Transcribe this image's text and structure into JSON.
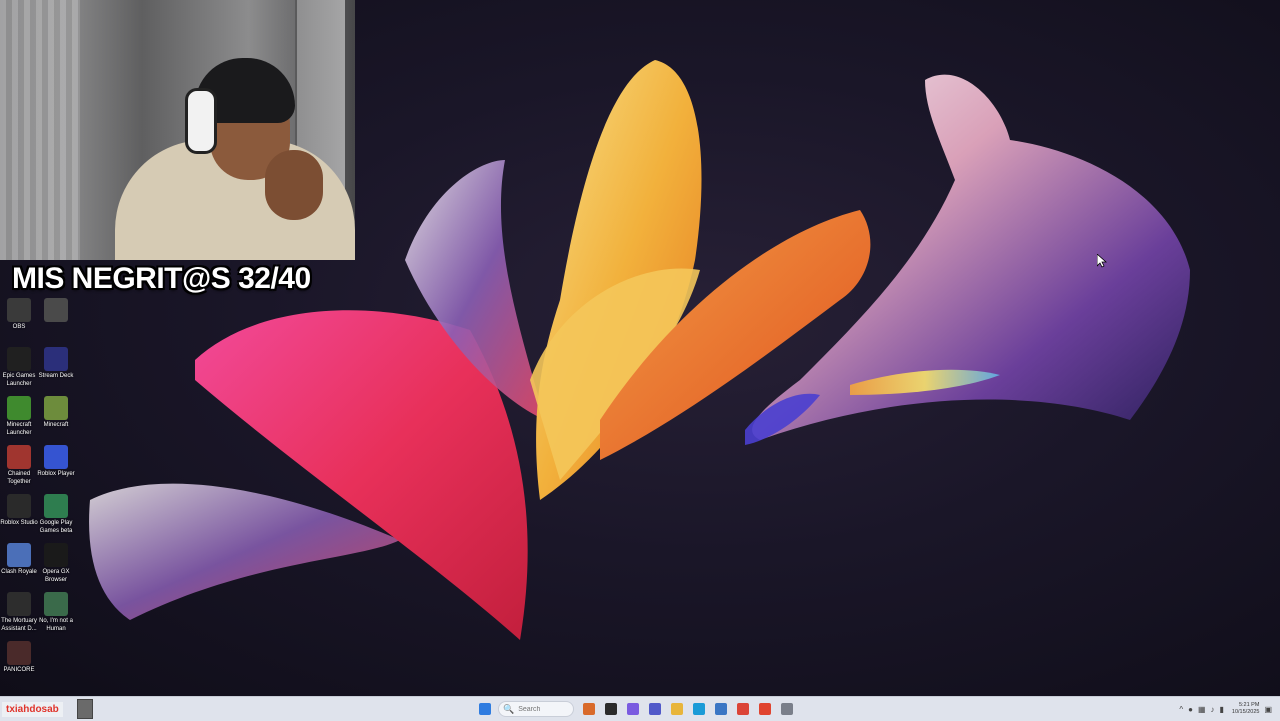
{
  "stream": {
    "title": "MIS NEGRIT@S 32/40"
  },
  "desktop_icons": [
    {
      "label": "OBS",
      "icon": "obs-icon",
      "color": "#3a3a3a"
    },
    {
      "label": "",
      "icon": "app-icon",
      "color": "#4a4a4a"
    },
    {
      "label": "Epic Games Launcher",
      "icon": "epic-games-icon",
      "color": "#202020"
    },
    {
      "label": "Stream Deck",
      "icon": "stream-deck-icon",
      "color": "#2b2f7a"
    },
    {
      "label": "Minecraft Launcher",
      "icon": "minecraft-launcher-icon",
      "color": "#3f8a2e"
    },
    {
      "label": "Minecraft",
      "icon": "minecraft-icon",
      "color": "#6d8c3c"
    },
    {
      "label": "Chained Together",
      "icon": "chained-together-icon",
      "color": "#a0352f"
    },
    {
      "label": "Roblox Player",
      "icon": "roblox-player-icon",
      "color": "#3554d1"
    },
    {
      "label": "Roblox Studio",
      "icon": "roblox-studio-icon",
      "color": "#2a2a2a"
    },
    {
      "label": "Google Play Games beta",
      "icon": "google-play-games-icon",
      "color": "#2e7d4f"
    },
    {
      "label": "Clash Royale",
      "icon": "clash-royale-icon",
      "color": "#4b6fb8"
    },
    {
      "label": "Opera GX Browser",
      "icon": "opera-gx-icon",
      "color": "#1a1a1a"
    },
    {
      "label": "The Mortuary Assistant D...",
      "icon": "mortuary-assistant-icon",
      "color": "#2d2d2d"
    },
    {
      "label": "No, I'm not a Human",
      "icon": "not-a-human-icon",
      "color": "#3a6a4a"
    },
    {
      "label": "PANICORE",
      "icon": "panicore-icon",
      "color": "#4a2a2a"
    }
  ],
  "taskbar": {
    "status_text": "txiahdosab",
    "search_placeholder": "Search",
    "pinned": [
      {
        "name": "start-button",
        "icon": "windows-icon",
        "color": "#2f7ce0"
      },
      {
        "name": "taskbar-widget",
        "icon": "widget-icon",
        "color": "#d96a2a"
      },
      {
        "name": "taskbar-terminal",
        "icon": "terminal-icon",
        "color": "#2b2b2b"
      },
      {
        "name": "taskbar-copilot",
        "icon": "copilot-icon",
        "color": "#7a5be0"
      },
      {
        "name": "taskbar-teams",
        "icon": "teams-icon",
        "color": "#5059c9"
      },
      {
        "name": "taskbar-file-explorer",
        "icon": "folder-icon",
        "color": "#e8b53a"
      },
      {
        "name": "taskbar-edge",
        "icon": "edge-icon",
        "color": "#1a9bd7"
      },
      {
        "name": "taskbar-store",
        "icon": "store-icon",
        "color": "#3a76c4"
      },
      {
        "name": "taskbar-chrome",
        "icon": "chrome-icon",
        "color": "#db4437"
      },
      {
        "name": "taskbar-app",
        "icon": "app-icon",
        "color": "#e0442f"
      },
      {
        "name": "taskbar-settings",
        "icon": "gear-icon",
        "color": "#7a7f8a"
      }
    ],
    "clock_time": "5:21 PM",
    "clock_date": "10/15/2025"
  },
  "colors": {
    "title_text": "#ffffff",
    "status_text": "#e0332b",
    "taskbar_bg": "#dfe3ec",
    "wallpaper_bg": "#1a1628"
  }
}
